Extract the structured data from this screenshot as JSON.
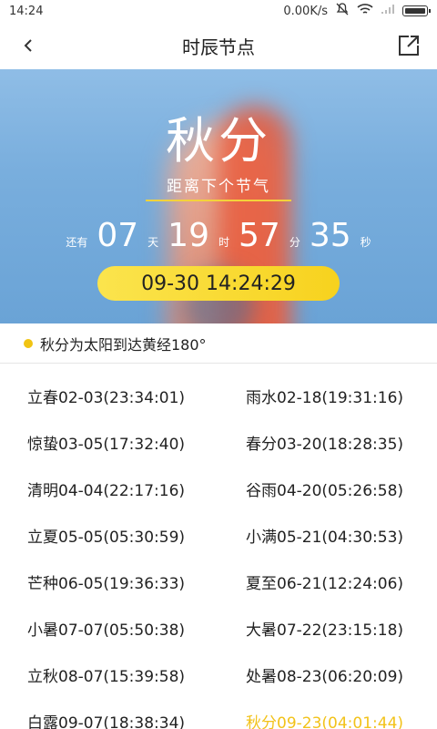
{
  "status_bar": {
    "time": "14:24",
    "network_speed": "0.00K/s"
  },
  "nav": {
    "title": "时辰节点"
  },
  "hero": {
    "term_name": "秋分",
    "next_label": "距离下个节气",
    "countdown": {
      "prefix": "还有",
      "days": "07",
      "days_unit": "天",
      "hours": "19",
      "hours_unit": "时",
      "minutes": "57",
      "minutes_unit": "分",
      "seconds": "35",
      "seconds_unit": "秒"
    },
    "target_time": "09-30 14:24:29"
  },
  "info": {
    "text": "秋分为太阳到达黄经180°",
    "dot_color": "#f1c413"
  },
  "terms": [
    [
      "立春02-03(23:34:01)",
      "雨水02-18(19:31:16)"
    ],
    [
      "惊蛰03-05(17:32:40)",
      "春分03-20(18:28:35)"
    ],
    [
      "清明04-04(22:17:16)",
      "谷雨04-20(05:26:58)"
    ],
    [
      "立夏05-05(05:30:59)",
      "小满05-21(04:30:53)"
    ],
    [
      "芒种06-05(19:36:33)",
      "夏至06-21(12:24:06)"
    ],
    [
      "小暑07-07(05:50:38)",
      "大暑07-22(23:15:18)"
    ],
    [
      "立秋08-07(15:39:58)",
      "处暑08-23(06:20:09)"
    ],
    [
      "白露09-07(18:38:34)",
      "秋分09-23(04:01:44)"
    ]
  ],
  "active_term": "秋分09-23(04:01:44)",
  "colors": {
    "accent": "#f2c21a"
  }
}
